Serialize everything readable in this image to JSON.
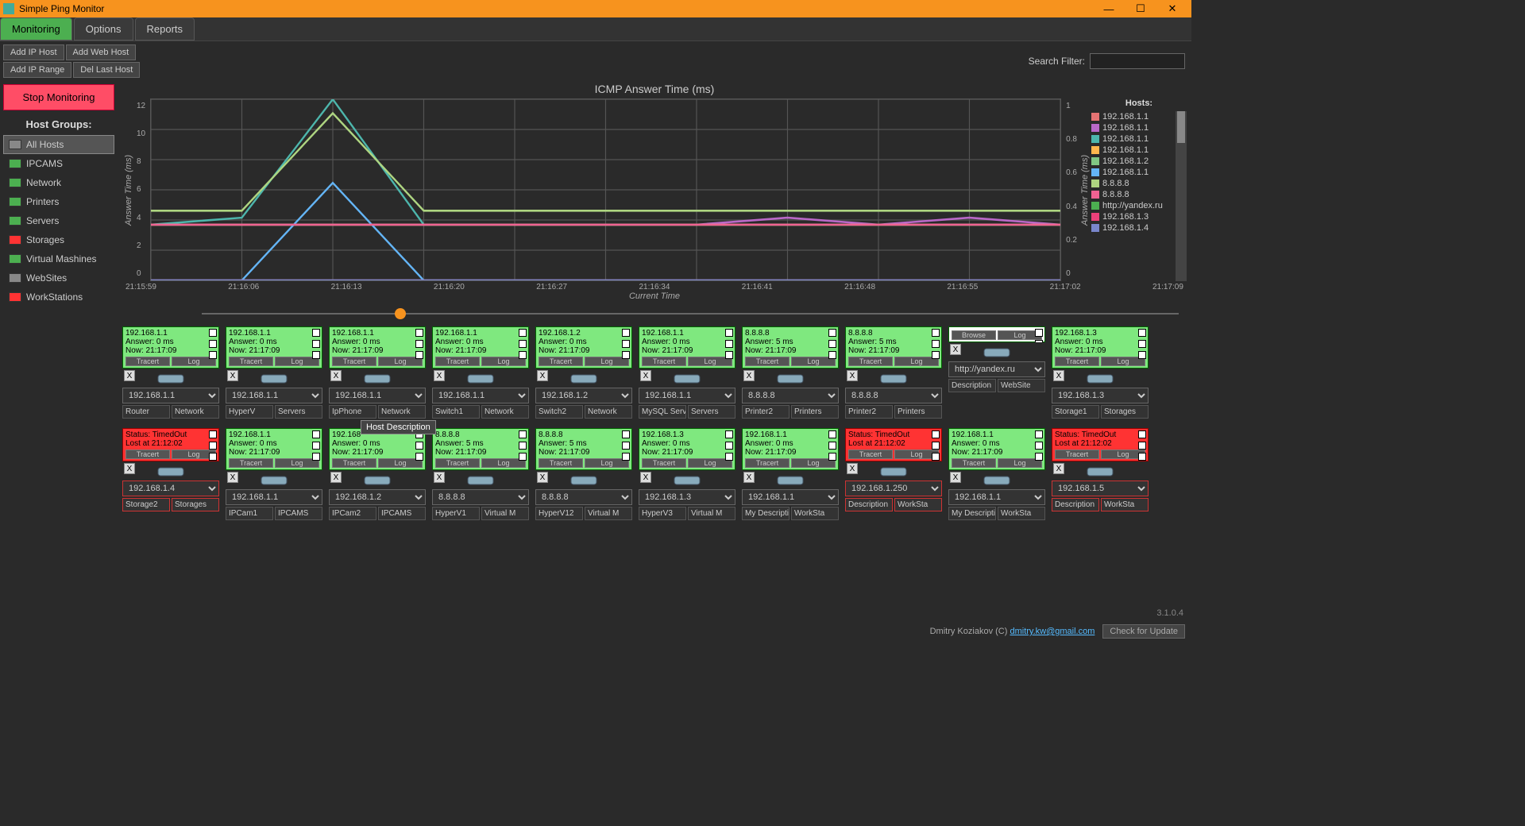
{
  "window_title": "Simple Ping Monitor",
  "tabs": {
    "monitoring": "Monitoring",
    "options": "Options",
    "reports": "Reports"
  },
  "buttons": {
    "add_ip_host": "Add IP Host",
    "add_web_host": "Add Web Host",
    "add_ip_range": "Add IP Range",
    "del_last_host": "Del Last Host",
    "stop": "Stop Monitoring",
    "tracert": "Tracert",
    "log": "Log",
    "browse": "Browse",
    "check_update": "Check for Update"
  },
  "search_label": "Search Filter:",
  "sidebar": {
    "title": "Host Groups:",
    "items": [
      {
        "label": "All Hosts",
        "color": "#888",
        "active": true
      },
      {
        "label": "IPCAMS",
        "color": "#4CAF50"
      },
      {
        "label": "Network",
        "color": "#4CAF50"
      },
      {
        "label": "Printers",
        "color": "#4CAF50"
      },
      {
        "label": "Servers",
        "color": "#4CAF50"
      },
      {
        "label": "Storages",
        "color": "#ff3333"
      },
      {
        "label": "Virtual Mashines",
        "color": "#4CAF50"
      },
      {
        "label": "WebSites",
        "color": "#888"
      },
      {
        "label": "WorkStations",
        "color": "#ff3333"
      }
    ]
  },
  "chart_data": {
    "type": "line",
    "title": "ICMP Answer Time (ms)",
    "ylabel": "Answer Time (ms)",
    "ylabel_right": "Answer Time (ms)",
    "xlabel": "Current Time",
    "categories": [
      "21:15:59",
      "21:16:06",
      "21:16:13",
      "21:16:20",
      "21:16:27",
      "21:16:34",
      "21:16:41",
      "21:16:48",
      "21:16:55",
      "21:17:02",
      "21:17:09"
    ],
    "ylim": [
      0,
      13
    ],
    "ylim_right": [
      0,
      1
    ],
    "yticks": [
      0,
      2,
      4,
      6,
      8,
      10,
      12
    ],
    "yticks_right": [
      0,
      0.2,
      0.4,
      0.6,
      0.8,
      1
    ],
    "series": [
      {
        "name": "192.168.1.1",
        "color": "#e57373",
        "values": [
          4,
          4,
          4,
          4,
          4,
          4,
          4,
          4,
          4,
          4,
          4
        ]
      },
      {
        "name": "192.168.1.1",
        "color": "#ba68c8",
        "values": [
          4,
          4,
          4,
          4,
          4,
          4,
          4,
          4.5,
          4,
          4.5,
          4
        ]
      },
      {
        "name": "192.168.1.1",
        "color": "#4db6ac",
        "values": [
          4,
          4.5,
          13,
          4,
          4,
          4,
          4,
          4,
          4,
          4,
          4
        ]
      },
      {
        "name": "192.168.1.1",
        "color": "#ffb74d",
        "values": [
          4,
          4,
          4,
          4,
          4,
          4,
          4,
          4,
          4,
          4,
          4
        ]
      },
      {
        "name": "192.168.1.2",
        "color": "#81c784",
        "values": [
          4,
          4,
          4,
          4,
          4,
          4,
          4,
          4,
          4,
          4,
          4
        ]
      },
      {
        "name": "192.168.1.1",
        "color": "#64b5f6",
        "values": [
          0,
          0,
          7,
          0,
          0,
          0,
          0,
          0,
          0,
          0,
          0
        ]
      },
      {
        "name": "8.8.8.8",
        "color": "#aed581",
        "values": [
          5,
          5,
          12,
          5,
          5,
          5,
          5,
          5,
          5,
          5,
          5
        ]
      },
      {
        "name": "8.8.8.8",
        "color": "#f06292",
        "values": [
          4,
          4,
          4,
          4,
          4,
          4,
          4,
          4,
          4,
          4,
          4
        ]
      },
      {
        "name": "http://yandex.ru",
        "color": "#4CAF50",
        "values": [
          0,
          0,
          0,
          0,
          0,
          0,
          0,
          0,
          0,
          0,
          0
        ]
      },
      {
        "name": "192.168.1.3",
        "color": "#ec407a",
        "values": [
          0,
          0,
          0,
          0,
          0,
          0,
          0,
          0,
          0,
          0,
          0
        ]
      },
      {
        "name": "192.168.1.4",
        "color": "#7986cb",
        "values": [
          0,
          0,
          0,
          0,
          0,
          0,
          0,
          0,
          0,
          0,
          0
        ]
      }
    ]
  },
  "legend_title": "Hosts:",
  "cards_row1": [
    {
      "ip": "192.168.1.1",
      "answer": "Answer: 0 ms",
      "now": "Now: 21:17:09",
      "sel": "192.168.1.1",
      "desc": "Router",
      "grp": "Network",
      "status": "ok"
    },
    {
      "ip": "192.168.1.1",
      "answer": "Answer: 0 ms",
      "now": "Now: 21:17:09",
      "sel": "192.168.1.1",
      "desc": "HyperV",
      "grp": "Servers",
      "status": "ok"
    },
    {
      "ip": "192.168.1.1",
      "answer": "Answer: 0 ms",
      "now": "Now: 21:17:09",
      "sel": "192.168.1.1",
      "desc": "IpPhone",
      "grp": "Network",
      "status": "ok",
      "highlight": true
    },
    {
      "ip": "192.168.1.1",
      "answer": "Answer: 0 ms",
      "now": "Now: 21:17:09",
      "sel": "192.168.1.1",
      "desc": "Switch1",
      "grp": "Network",
      "status": "ok"
    },
    {
      "ip": "192.168.1.2",
      "answer": "Answer: 0 ms",
      "now": "Now: 21:17:09",
      "sel": "192.168.1.2",
      "desc": "Switch2",
      "grp": "Network",
      "status": "ok"
    },
    {
      "ip": "192.168.1.1",
      "answer": "Answer: 0 ms",
      "now": "Now: 21:17:09",
      "sel": "192.168.1.1",
      "desc": "MySQL Serv",
      "grp": "Servers",
      "status": "ok"
    },
    {
      "ip": "8.8.8.8",
      "answer": "Answer: 5 ms",
      "now": "Now: 21:17:09",
      "sel": "8.8.8.8",
      "desc": "Printer2",
      "grp": "Printers",
      "status": "ok"
    },
    {
      "ip": "8.8.8.8",
      "answer": "Answer: 5 ms",
      "now": "Now: 21:17:09",
      "sel": "8.8.8.8",
      "desc": "Printer2",
      "grp": "Printers",
      "status": "ok"
    },
    {
      "ip": "",
      "answer": "",
      "now": "",
      "sel": "http://yandex.ru",
      "desc": "Description",
      "grp": "WebSite",
      "status": "white"
    },
    {
      "ip": "192.168.1.3",
      "answer": "Answer: 0 ms",
      "now": "Now: 21:17:09",
      "sel": "192.168.1.3",
      "desc": "Storage1",
      "grp": "Storages",
      "status": "ok"
    }
  ],
  "cards_row2": [
    {
      "ip": "Status: TimedOut",
      "answer": "Lost at 21:12:02",
      "now": "",
      "sel": "192.168.1.4",
      "desc": "Storage2",
      "grp": "Storages",
      "status": "red"
    },
    {
      "ip": "192.168.1.1",
      "answer": "Answer: 0 ms",
      "now": "Now: 21:17:09",
      "sel": "192.168.1.1",
      "desc": "IPCam1",
      "grp": "IPCAMS",
      "status": "ok"
    },
    {
      "ip": "192.168",
      "answer": "Answer: 0 ms",
      "now": "Now: 21:17:09",
      "sel": "192.168.1.2",
      "desc": "IPCam2",
      "grp": "IPCAMS",
      "status": "ok"
    },
    {
      "ip": "8.8.8.8",
      "answer": "Answer: 5 ms",
      "now": "Now: 21:17:09",
      "sel": "8.8.8.8",
      "desc": "HyperV1",
      "grp": "Virtual M",
      "status": "ok"
    },
    {
      "ip": "8.8.8.8",
      "answer": "Answer: 5 ms",
      "now": "Now: 21:17:09",
      "sel": "8.8.8.8",
      "desc": "HyperV12",
      "grp": "Virtual M",
      "status": "ok"
    },
    {
      "ip": "192.168.1.3",
      "answer": "Answer: 0 ms",
      "now": "Now: 21:17:09",
      "sel": "192.168.1.3",
      "desc": "HyperV3",
      "grp": "Virtual M",
      "status": "ok"
    },
    {
      "ip": "192.168.1.1",
      "answer": "Answer: 0 ms",
      "now": "Now: 21:17:09",
      "sel": "192.168.1.1",
      "desc": "My Descripti",
      "grp": "WorkSta",
      "status": "ok"
    },
    {
      "ip": "Status: TimedOut",
      "answer": "Lost at 21:12:02",
      "now": "",
      "sel": "192.168.1.250",
      "desc": "Description",
      "grp": "WorkSta",
      "status": "red"
    },
    {
      "ip": "192.168.1.1",
      "answer": "Answer: 0 ms",
      "now": "Now: 21:17:09",
      "sel": "192.168.1.1",
      "desc": "My Descripti",
      "grp": "WorkSta",
      "status": "ok"
    },
    {
      "ip": "Status: TimedOut",
      "answer": "Lost at 21:12:02",
      "now": "",
      "sel": "192.168.1.5",
      "desc": "Description",
      "grp": "WorkSta",
      "status": "red"
    }
  ],
  "tooltip": "Host Description",
  "version": "3.1.0.4",
  "footer": {
    "author": "Dmitry Koziakov (C)",
    "email": "dmitry.kw@gmail.com"
  }
}
